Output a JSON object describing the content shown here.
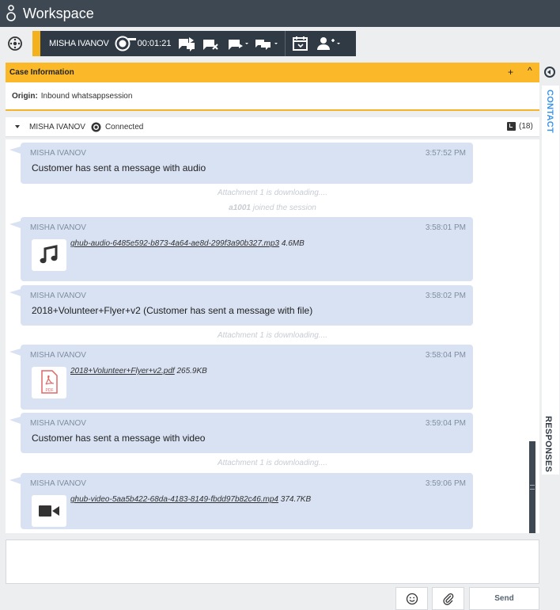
{
  "app": {
    "title": "Workspace",
    "logo_icon": "genesys-logo-icon"
  },
  "toolbar": {
    "left_icon": "hub-icon",
    "contact_name": "MISHA IVANOV",
    "timer": "00:01:21",
    "accent_color": "#f3b21b",
    "icons": [
      "whatsapp-icon",
      "transfer-chat-icon",
      "end-chat-icon",
      "conference-chat-icon",
      "consult-chat-icon",
      "schedule-callback-icon",
      "party-action-icon"
    ]
  },
  "case_info": {
    "header": "Case Information",
    "add_label": "+",
    "collapse_label": "^",
    "origin_label": "Origin:",
    "origin_value": "Inbound whatsappsession"
  },
  "side_tabs": {
    "contact": "CONTACT",
    "responses": "RESPONSES"
  },
  "participant": {
    "name": "MISHA IVANOV",
    "status": "Connected",
    "count": "(18)"
  },
  "transcript": {
    "messages": [
      {
        "author": "MISHA IVANOV",
        "time": "3:57:52 PM",
        "text": "Customer has sent a message with audio"
      },
      {
        "author": "MISHA IVANOV",
        "time": "3:58:01 PM",
        "file": "ghub-audio-6485e592-b873-4a64-ae8d-299f3a90b327.mp3",
        "size": "4.6MB",
        "icon": "music-note-icon"
      },
      {
        "author": "MISHA IVANOV",
        "time": "3:58:02 PM",
        "text": "2018+Volunteer+Flyer+v2 (Customer has sent a message with file)"
      },
      {
        "author": "MISHA IVANOV",
        "time": "3:58:04 PM",
        "file": "2018+Volunteer+Flyer+v2.pdf",
        "size": "265.9KB",
        "icon": "pdf-icon"
      },
      {
        "author": "MISHA IVANOV",
        "time": "3:59:04 PM",
        "text": "Customer has sent a message with video"
      },
      {
        "author": "MISHA IVANOV",
        "time": "3:59:06 PM",
        "file": "ghub-video-5aa5b422-68da-4183-8149-fbdd97b82c46.mp4",
        "size": "374.7KB",
        "icon": "video-camera-icon"
      }
    ],
    "notes": {
      "downloading": "Attachment 1 is downloading....",
      "downloading_2": "Attachment 1 is downloading....",
      "downloading_3": "Attachment 1 is downloading....",
      "joined_user": "a1001",
      "joined_text": " joined the session"
    }
  },
  "composer": {
    "emoji_icon": "smiley-icon",
    "attach_icon": "paperclip-icon",
    "send_label": "Send"
  }
}
